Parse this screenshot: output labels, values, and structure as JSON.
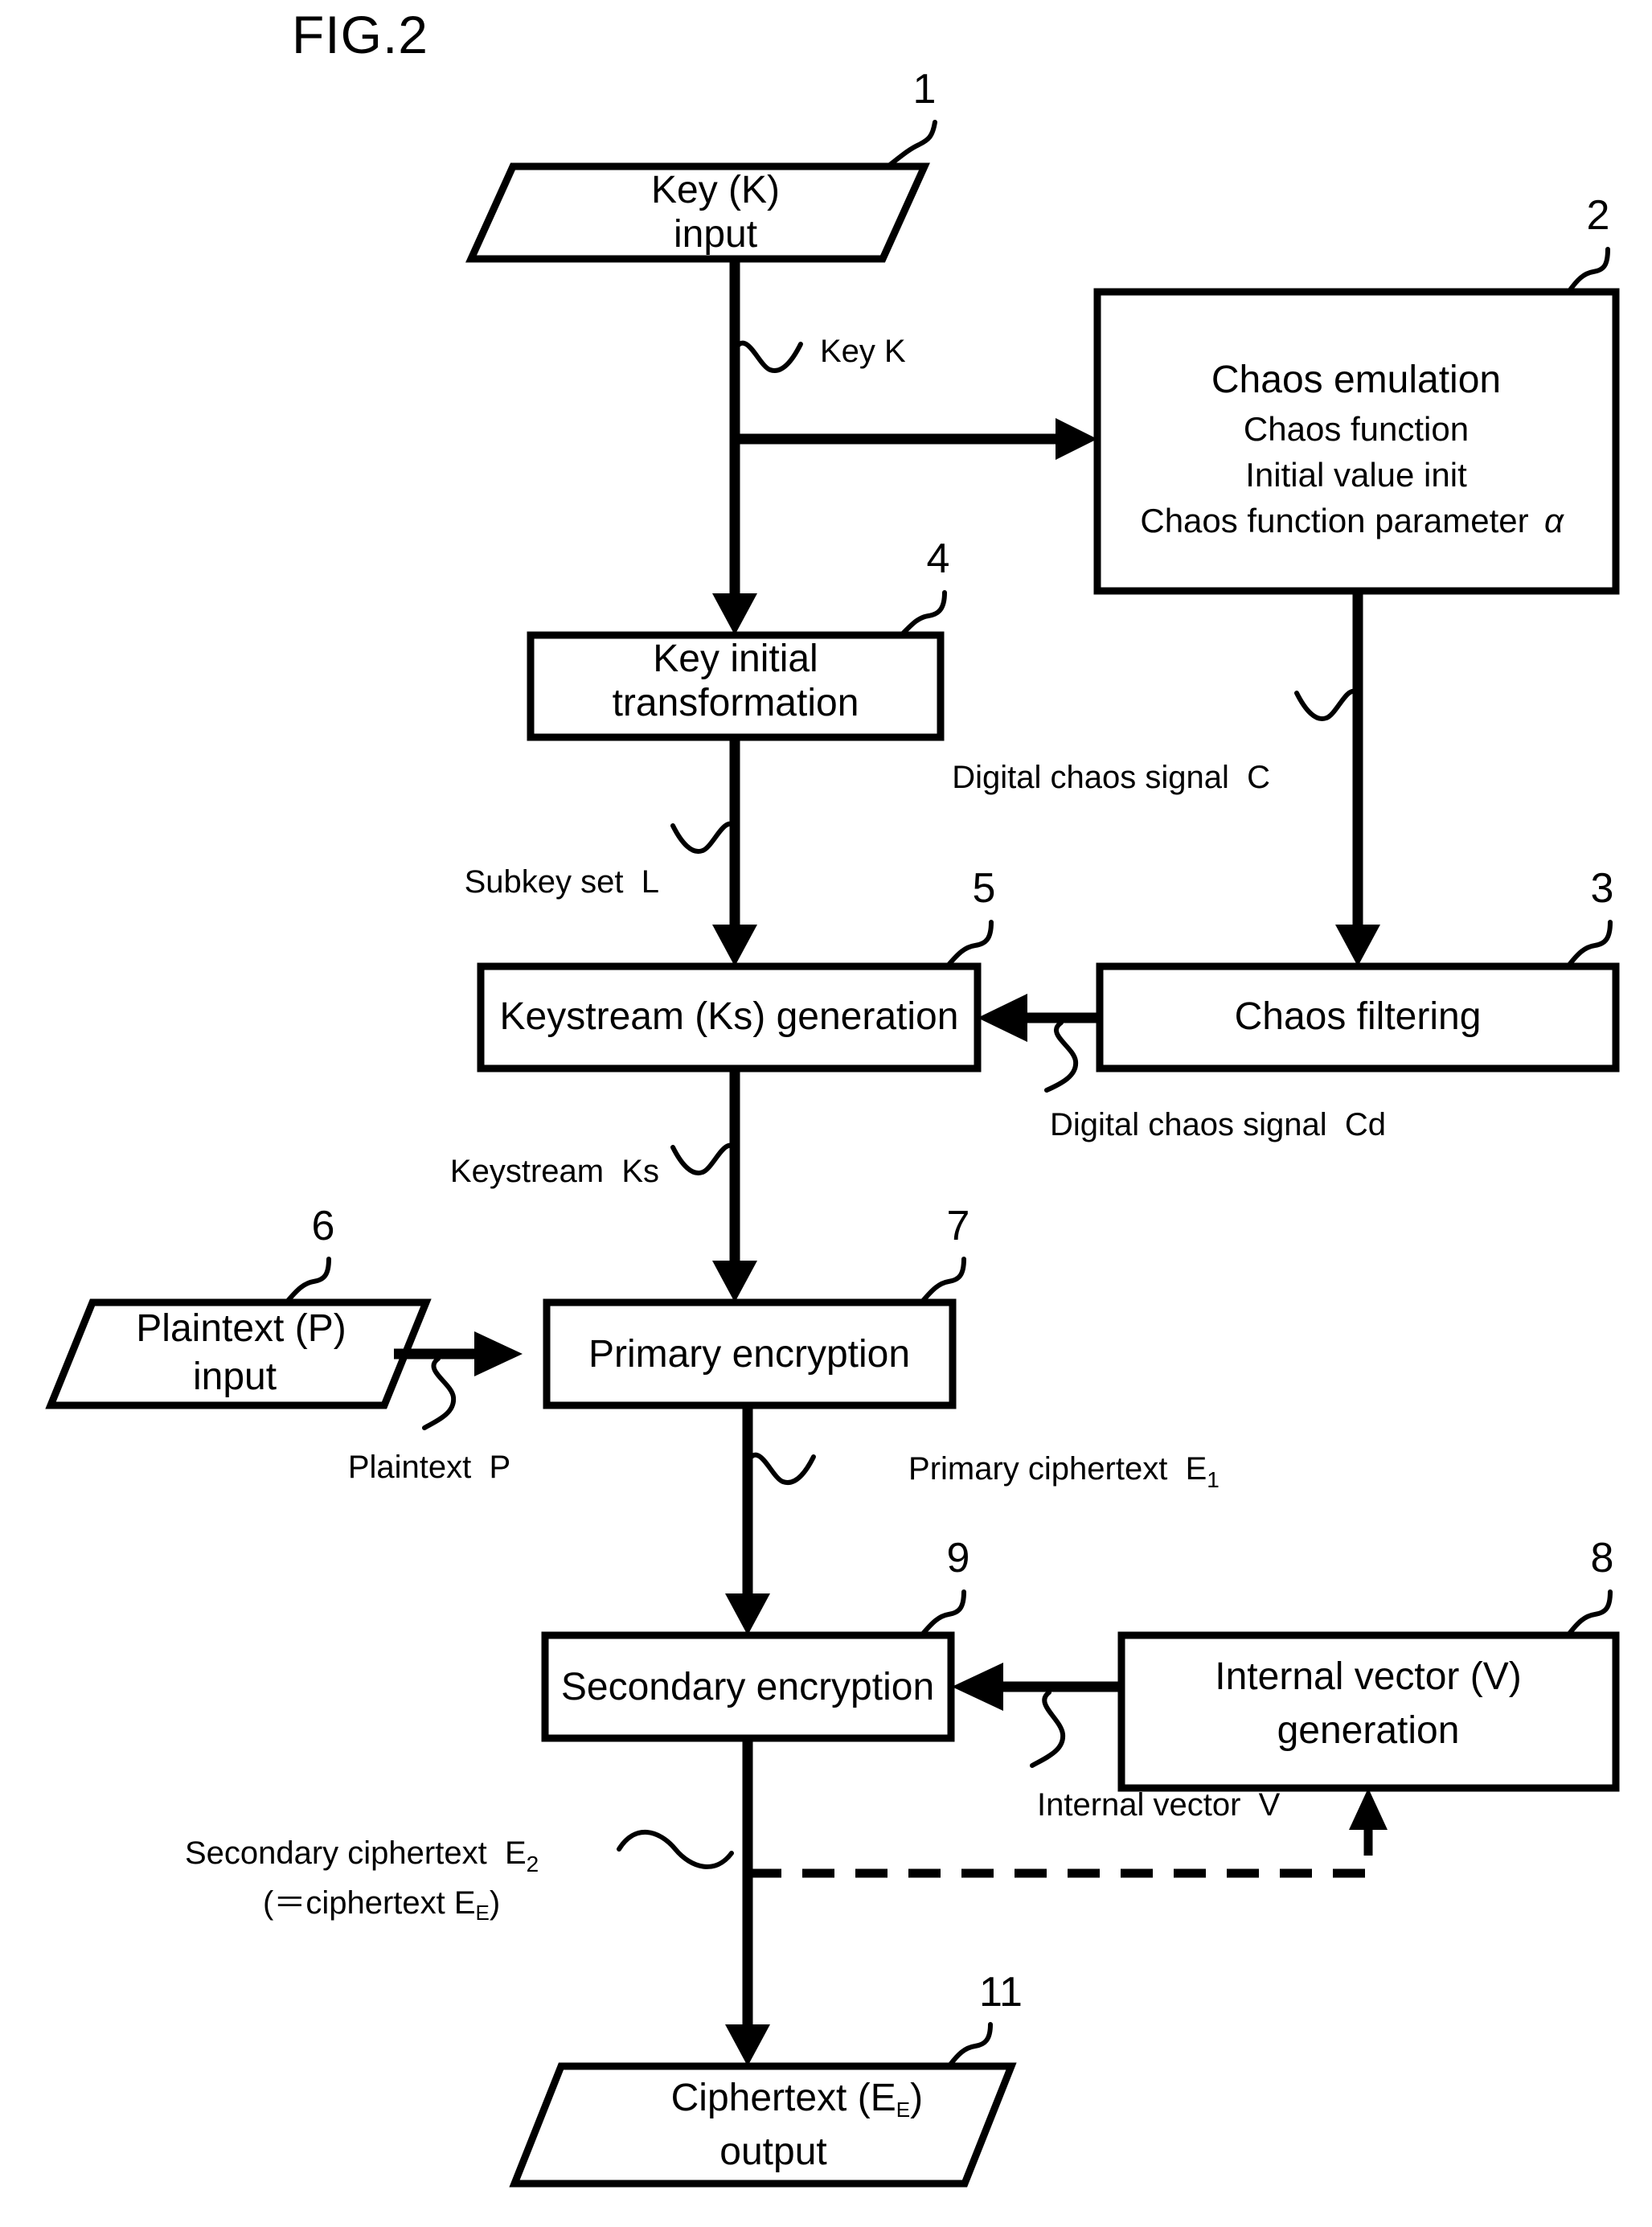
{
  "figure": {
    "title": "FIG.2",
    "type": "flowchart",
    "line_color": "#000000",
    "background_color": "#ffffff"
  },
  "nodes": {
    "key_input": {
      "ref": "1",
      "shape": "parallelogram",
      "line1": "Key (K)",
      "line2": "input"
    },
    "chaos_emulation": {
      "ref": "2",
      "shape": "rectangle",
      "line1": "Chaos emulation",
      "line2": "Chaos function",
      "line3": "Initial value init",
      "line4": "Chaos function parameter",
      "line4_symbol": "α"
    },
    "key_initial_transformation": {
      "ref": "4",
      "shape": "rectangle",
      "line1": "Key initial",
      "line2": "transformation"
    },
    "keystream_generation": {
      "ref": "5",
      "shape": "rectangle",
      "line1": "Keystream (Ks) generation"
    },
    "chaos_filtering": {
      "ref": "3",
      "shape": "rectangle",
      "line1": "Chaos filtering"
    },
    "plaintext_input": {
      "ref": "6",
      "shape": "parallelogram",
      "line1": "Plaintext (P)",
      "line2": "input"
    },
    "primary_encryption": {
      "ref": "7",
      "shape": "rectangle",
      "line1": "Primary encryption"
    },
    "internal_vector_generation": {
      "ref": "8",
      "shape": "rectangle",
      "line1": "Internal vector (V)",
      "line2": "generation"
    },
    "secondary_encryption": {
      "ref": "9",
      "shape": "rectangle",
      "line1": "Secondary encryption"
    },
    "ciphertext_output": {
      "ref": "11",
      "shape": "parallelogram",
      "line1_main": "Ciphertext (E",
      "line1_sub": "E",
      "line1_tail": ")",
      "line2": "output"
    }
  },
  "edge_labels": {
    "key_k": "Key K",
    "digital_chaos_signal_c": "Digital chaos signal  C",
    "subkey_set_l": "Subkey set  L",
    "digital_chaos_signal_cd": "Digital chaos signal  Cd",
    "keystream_ks": "Keystream  Ks",
    "plaintext_p": "Plaintext  P",
    "primary_ciphertext_main": "Primary ciphertext  E",
    "primary_ciphertext_sub": "1",
    "internal_vector_v": "Internal vector  V",
    "secondary_ciphertext_main": "Secondary ciphertext  E",
    "secondary_ciphertext_sub": "2",
    "secondary_ciphertext_alt_pre": "(＝ciphertext E",
    "secondary_ciphertext_alt_sub": "E",
    "secondary_ciphertext_alt_post": ")"
  }
}
